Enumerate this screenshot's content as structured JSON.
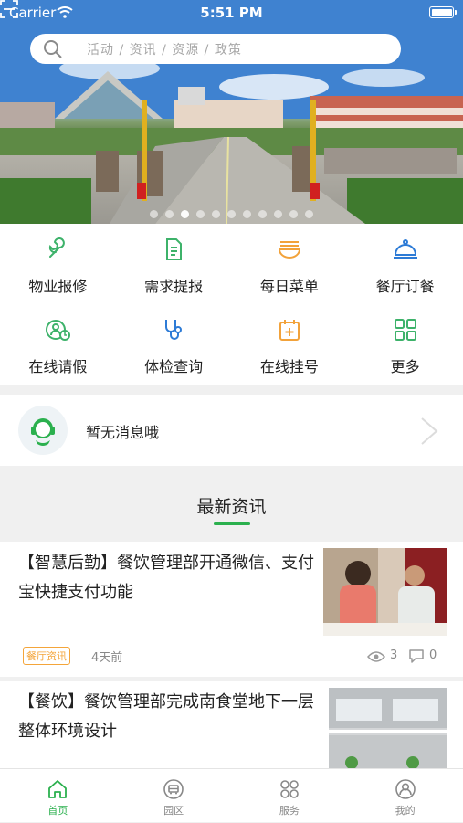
{
  "status": {
    "carrier": "Carrier",
    "time": "5:51 PM"
  },
  "search": {
    "placeholder": "活动 / 资讯 / 资源 / 政策"
  },
  "banner": {
    "slide_count": 11,
    "active_index": 2
  },
  "grid": [
    {
      "label": "物业报修",
      "icon": "wrench-icon"
    },
    {
      "label": "需求提报",
      "icon": "document-icon"
    },
    {
      "label": "每日菜单",
      "icon": "bowl-icon"
    },
    {
      "label": "餐厅订餐",
      "icon": "cloche-icon"
    },
    {
      "label": "在线请假",
      "icon": "leave-clock-icon"
    },
    {
      "label": "体检查询",
      "icon": "stethoscope-icon"
    },
    {
      "label": "在线挂号",
      "icon": "calendar-plus-icon"
    },
    {
      "label": "更多",
      "icon": "grid-more-icon"
    }
  ],
  "message": {
    "text": "暂无消息哦"
  },
  "news": {
    "title": "最新资讯",
    "items": [
      {
        "title": "【智慧后勤】餐饮管理部开通微信、支付宝快捷支付功能",
        "tag": "餐厅资讯",
        "time": "4天前",
        "views": "3",
        "comments": "0"
      },
      {
        "title": "【餐饮】餐饮管理部完成南食堂地下一层整体环境设计"
      }
    ]
  },
  "tabs": [
    {
      "label": "首页",
      "active": true
    },
    {
      "label": "园区",
      "active": false
    },
    {
      "label": "服务",
      "active": false
    },
    {
      "label": "我的",
      "active": false
    }
  ],
  "colors": {
    "accent": "#2bb04e",
    "tag": "#f4a53a",
    "icon_blue": "#2d7bd6",
    "icon_orange": "#f2a23a",
    "icon_green": "#3db26a"
  }
}
